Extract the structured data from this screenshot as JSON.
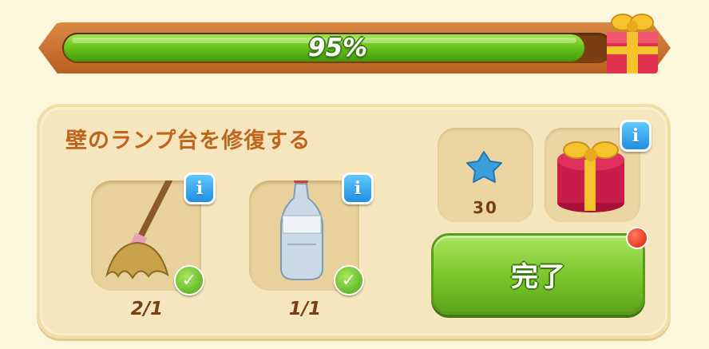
{
  "progress": {
    "value": 95,
    "label": "95%"
  },
  "quest": {
    "title": "壁のランプ台を修復する"
  },
  "requirements": [
    {
      "icon": "mop-icon",
      "count": "2/1",
      "completed": true
    },
    {
      "icon": "turpentine-bottle-icon",
      "count": "1/1",
      "completed": true
    }
  ],
  "rewards": [
    {
      "icon": "blue-star-icon",
      "count": "30"
    },
    {
      "icon": "gift-box-icon"
    }
  ],
  "actions": {
    "complete_label": "完了"
  },
  "info_label": "i",
  "colors": {
    "accent_green": "#79c52b",
    "title_orange": "#c0651e",
    "info_blue": "#1f8fe0"
  }
}
